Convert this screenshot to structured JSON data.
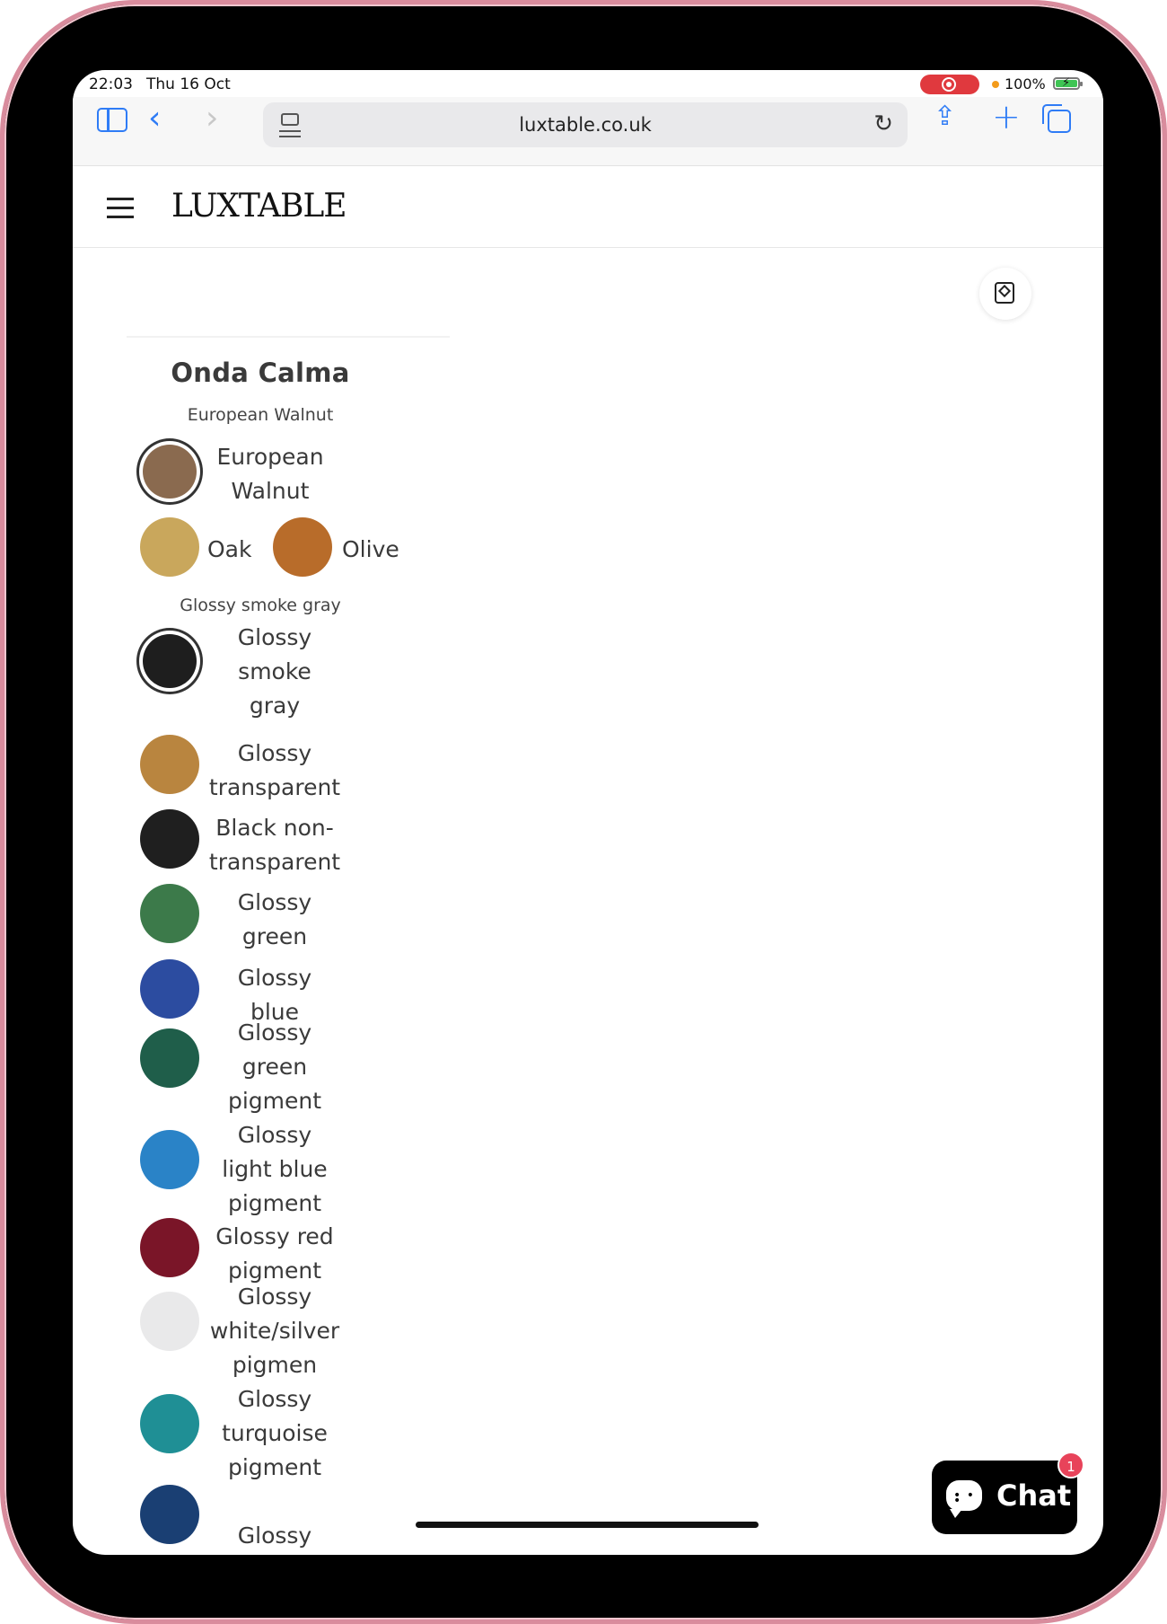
{
  "status_bar": {
    "time": "22:03",
    "date": "Thu 16 Oct",
    "battery": "100%"
  },
  "browser": {
    "url": "luxtable.co.uk"
  },
  "site": {
    "logo": "LUXTABLE"
  },
  "product": {
    "title": "Onda Calma",
    "wood_group_label": "European Walnut",
    "wood_options": [
      {
        "label_lines": [
          "European",
          "Walnut"
        ],
        "selected": true,
        "color": "#8a6a4f"
      },
      {
        "label_lines": [
          "Oak"
        ],
        "selected": false,
        "color": "#c9a75c"
      },
      {
        "label_lines": [
          "Olive"
        ],
        "selected": false,
        "color": "#b86c2a"
      }
    ],
    "finish_group_label": "Glossy smoke gray",
    "finish_options": [
      {
        "label_lines": [
          "Glossy",
          "smoke",
          "gray"
        ],
        "selected": true,
        "color": "#1e1e1e"
      },
      {
        "label_lines": [
          "Glossy",
          "transparent"
        ],
        "selected": false,
        "color": "#b9853f"
      },
      {
        "label_lines": [
          "Black non-",
          "transparent"
        ],
        "selected": false,
        "color": "#1f1f1f"
      },
      {
        "label_lines": [
          "Glossy",
          "green"
        ],
        "selected": false,
        "color": "#3c7a4a"
      },
      {
        "label_lines": [
          "Glossy",
          "blue"
        ],
        "selected": false,
        "color": "#2c4ca0"
      },
      {
        "label_lines": [
          "Glossy",
          "green",
          "pigment"
        ],
        "selected": false,
        "color": "#1f5e4a"
      },
      {
        "label_lines": [
          "Glossy",
          "light blue",
          "pigment"
        ],
        "selected": false,
        "color": "#2a83c7"
      },
      {
        "label_lines": [
          "Glossy red",
          "pigment"
        ],
        "selected": false,
        "color": "#7a1528"
      },
      {
        "label_lines": [
          "Glossy",
          "white/silver",
          "pigmen"
        ],
        "selected": false,
        "color": "#e9e9ea"
      },
      {
        "label_lines": [
          "Glossy",
          "turquoise",
          "pigment"
        ],
        "selected": false,
        "color": "#1f8f95"
      },
      {
        "label_lines": [
          "Glossy"
        ],
        "selected": false,
        "color": "#1a3f73"
      }
    ]
  },
  "chat": {
    "label": "Chat",
    "badge": "1"
  }
}
